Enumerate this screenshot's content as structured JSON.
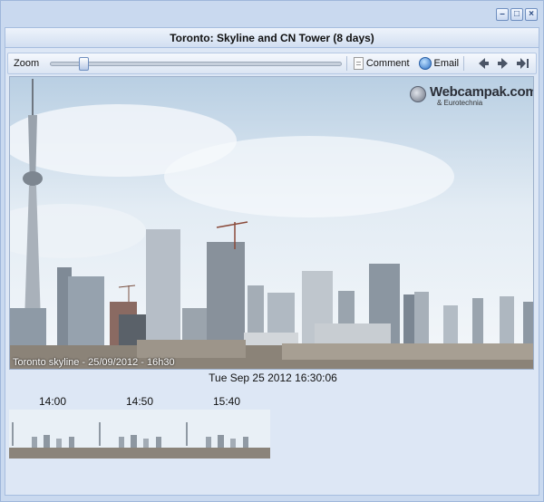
{
  "panel": {
    "title": "Toronto: Skyline and CN Tower (8 days)"
  },
  "toolbar": {
    "zoom_label": "Zoom",
    "zoom_level": 0.1,
    "comment_label": "Comment",
    "email_label": "Email"
  },
  "image": {
    "caption": "Toronto skyline - 25/09/2012 - 16h30",
    "logo_main": "Webcampak.com",
    "logo_sub": "& Eurotechnia"
  },
  "timestamp": "Tue Sep 25 2012 16:30:06",
  "thumbnails": [
    {
      "time": "14:00"
    },
    {
      "time": "14:50"
    },
    {
      "time": "15:40"
    }
  ]
}
